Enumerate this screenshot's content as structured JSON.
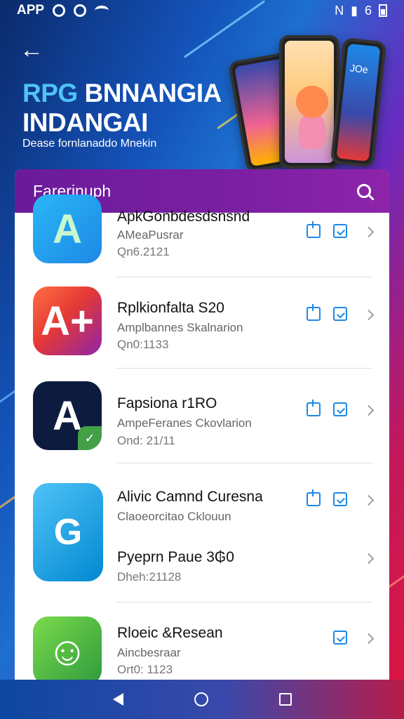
{
  "status_bar": {
    "app_label": "APP",
    "signal_text": "6"
  },
  "hero": {
    "title_accent": "RPG",
    "title_rest": " BNNANGIA",
    "title_line2": "INDANGAI",
    "subtitle": "Dease fornlanaddo Mnekin",
    "phone_text": "JOe"
  },
  "card": {
    "header_title": "Farerinuph",
    "items": [
      {
        "title": "ApkGonbdesdsnsnd",
        "subtitle": "AMeaPusrar",
        "date": "Qn6.2121",
        "icon": "gradient-a-icon",
        "actions": [
          "share",
          "save"
        ]
      },
      {
        "title": "Rplkionfalta S20",
        "subtitle": "Amplbannes Skalnarion",
        "date": "Qn0:1133",
        "icon": "a-plus-icon",
        "actions": [
          "share",
          "save"
        ]
      },
      {
        "title": "Fapsiona r1RO",
        "subtitle": "AmpeFeranes Ckovlarion",
        "date": "Ond: 21/11",
        "icon": "a-leaf-icon",
        "actions": [
          "share",
          "save"
        ]
      },
      {
        "title": "Alivic Camnd Curesna",
        "subtitle": "Claoeorcitao Cklouun",
        "date": "",
        "icon": "compass-icon",
        "actions": [
          "share",
          "save"
        ]
      },
      {
        "title": "Pyeprn Paue 3₲0",
        "subtitle": "",
        "date": "Dheh:21128",
        "icon": "",
        "actions": []
      },
      {
        "title": "Rloeic &Resean",
        "subtitle": "Aincbesraar",
        "date": "Ort0: 1123",
        "icon": "android-icon",
        "actions": [
          "save"
        ]
      }
    ]
  },
  "colors": {
    "accent_blue": "#1e88e5",
    "header_purple": "#7b1fa2",
    "divider": "#e0e0e0"
  }
}
